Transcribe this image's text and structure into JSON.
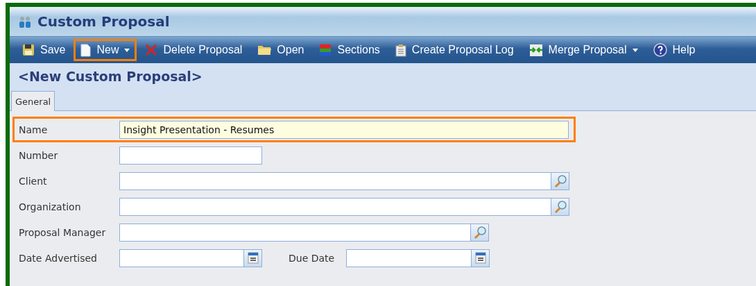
{
  "window": {
    "title": "Custom Proposal"
  },
  "toolbar": [
    {
      "kind": "save",
      "label": "Save",
      "dropdown": false,
      "highlighted": false
    },
    {
      "kind": "new",
      "label": "New",
      "dropdown": true,
      "highlighted": true
    },
    {
      "kind": "delete",
      "label": "Delete Proposal",
      "dropdown": false,
      "highlighted": false
    },
    {
      "kind": "open",
      "label": "Open",
      "dropdown": false,
      "highlighted": false
    },
    {
      "kind": "sections",
      "label": "Sections",
      "dropdown": false,
      "highlighted": false
    },
    {
      "kind": "log",
      "label": "Create Proposal Log",
      "dropdown": false,
      "highlighted": false
    },
    {
      "kind": "merge",
      "label": "Merge Proposal",
      "dropdown": true,
      "highlighted": false
    },
    {
      "kind": "help",
      "label": "Help",
      "dropdown": false,
      "highlighted": false
    }
  ],
  "heading": "<New Custom Proposal>",
  "tabs": [
    {
      "label": "General",
      "selected": true
    }
  ],
  "form": [
    {
      "kind": "wide",
      "label": "Name",
      "value": "Insight Presentation - Resumes",
      "focused": true,
      "highlighted": true
    },
    {
      "kind": "short",
      "label": "Number",
      "focused": false,
      "highlighted": false
    },
    {
      "kind": "lookup",
      "label": "Client",
      "focused": false,
      "highlighted": false
    },
    {
      "kind": "lookup",
      "label": "Organization",
      "focused": false,
      "highlighted": false
    },
    {
      "kind": "short-lookup",
      "label": "Proposal Manager",
      "focused": false,
      "highlighted": false
    },
    {
      "kind": "date-pair",
      "label": "Date Advertised",
      "second_label": "Due Date",
      "focused": false,
      "highlighted": false
    }
  ]
}
